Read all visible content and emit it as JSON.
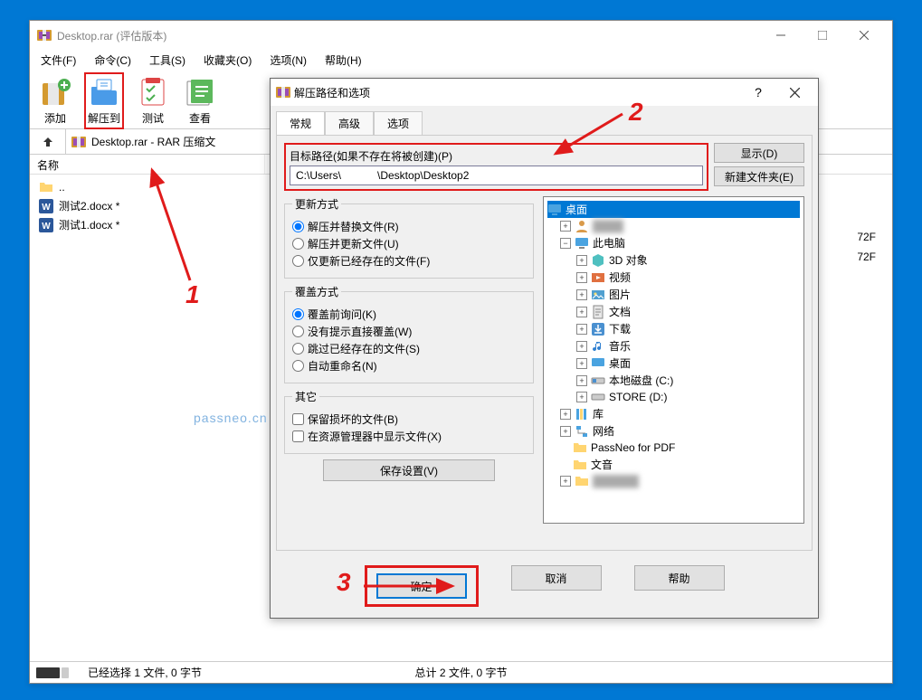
{
  "mainWindow": {
    "title": "Desktop.rar (评估版本)",
    "menu": [
      "文件(F)",
      "命令(C)",
      "工具(S)",
      "收藏夹(O)",
      "选项(N)",
      "帮助(H)"
    ],
    "toolbar": {
      "add": "添加",
      "extract": "解压到",
      "test": "测试",
      "view": "查看"
    },
    "path": "Desktop.rar - RAR 压缩文",
    "colName": "名称",
    "files": {
      "up": "..",
      "f1": "测试2.docx *",
      "f2": "测试1.docx *"
    },
    "fileSuffix1": "72F",
    "fileSuffix2": "72F",
    "statusLeft": "已经选择 1 文件, 0 字节",
    "statusRight": "总计 2 文件, 0 字节"
  },
  "dialog": {
    "title": "解压路径和选项",
    "help": "?",
    "tabs": {
      "general": "常规",
      "advanced": "高级",
      "options": "选项"
    },
    "pathLabel": "目标路径(如果不存在将被创建)(P)",
    "pathValue": "C:\\Users\\            \\Desktop\\Desktop2",
    "showBtn": "显示(D)",
    "newFolderBtn": "新建文件夹(E)",
    "updateMode": {
      "legend": "更新方式",
      "replace": "解压并替换文件(R)",
      "update": "解压并更新文件(U)",
      "freshen": "仅更新已经存在的文件(F)"
    },
    "overwriteMode": {
      "legend": "覆盖方式",
      "ask": "覆盖前询问(K)",
      "silent": "没有提示直接覆盖(W)",
      "skip": "跳过已经存在的文件(S)",
      "rename": "自动重命名(N)"
    },
    "misc": {
      "legend": "其它",
      "keepBroken": "保留损坏的文件(B)",
      "explorer": "在资源管理器中显示文件(X)"
    },
    "saveBtn": "保存设置(V)",
    "tree": {
      "desktop": "桌面",
      "user": "",
      "thisPc": "此电脑",
      "objects3d": "3D 对象",
      "videos": "视频",
      "pictures": "图片",
      "documents": "文档",
      "downloads": "下载",
      "music": "音乐",
      "desktopFolder": "桌面",
      "localDisk": "本地磁盘 (C:)",
      "store": "STORE (D:)",
      "libraries": "库",
      "network": "网络",
      "passneo": "PassNeo for PDF",
      "wenyin": "文音"
    },
    "ok": "确定",
    "cancel": "取消",
    "helpBtn": "帮助"
  },
  "annotations": {
    "n1": "1",
    "n2": "2",
    "n3": "3"
  },
  "watermark": "passneo.cn"
}
